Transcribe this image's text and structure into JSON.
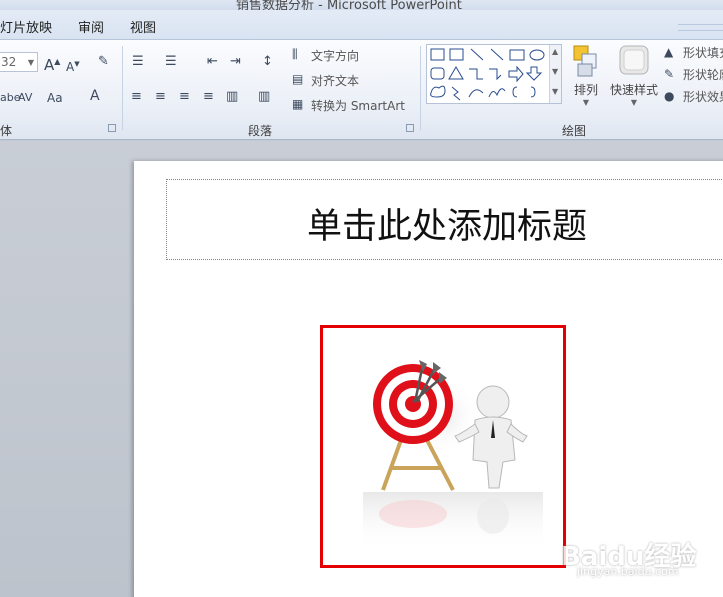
{
  "window": {
    "title": "销售数据分析 - Microsoft PowerPoint"
  },
  "menu": {
    "tabs": [
      "灯片放映",
      "审阅",
      "视图"
    ]
  },
  "ribbon": {
    "font": {
      "group_label": "体",
      "font_size": "32"
    },
    "paragraph": {
      "group_label": "段落",
      "text_direction_label": "文字方向",
      "align_text_label": "对齐文本",
      "convert_smartart_label": "转换为 SmartArt"
    },
    "drawing": {
      "group_label": "绘图",
      "arrange_label": "排列",
      "quick_styles_label": "快速样式",
      "shape_fill_label": "形状填充",
      "shape_outline_label": "形状轮廓",
      "shape_effects_label": "形状效果"
    }
  },
  "slide": {
    "title_placeholder": "单击此处添加标题",
    "picture_description": "target with arrows and 3D figure clip art"
  },
  "watermark": {
    "brand": "Baidu经验",
    "url": "jingyan.baidu.com"
  },
  "colors": {
    "frame_red": "#e40000",
    "target_red": "#e0101a",
    "ribbon_bg": "#e9eef6",
    "workspace_bg": "#c4c9d1"
  }
}
